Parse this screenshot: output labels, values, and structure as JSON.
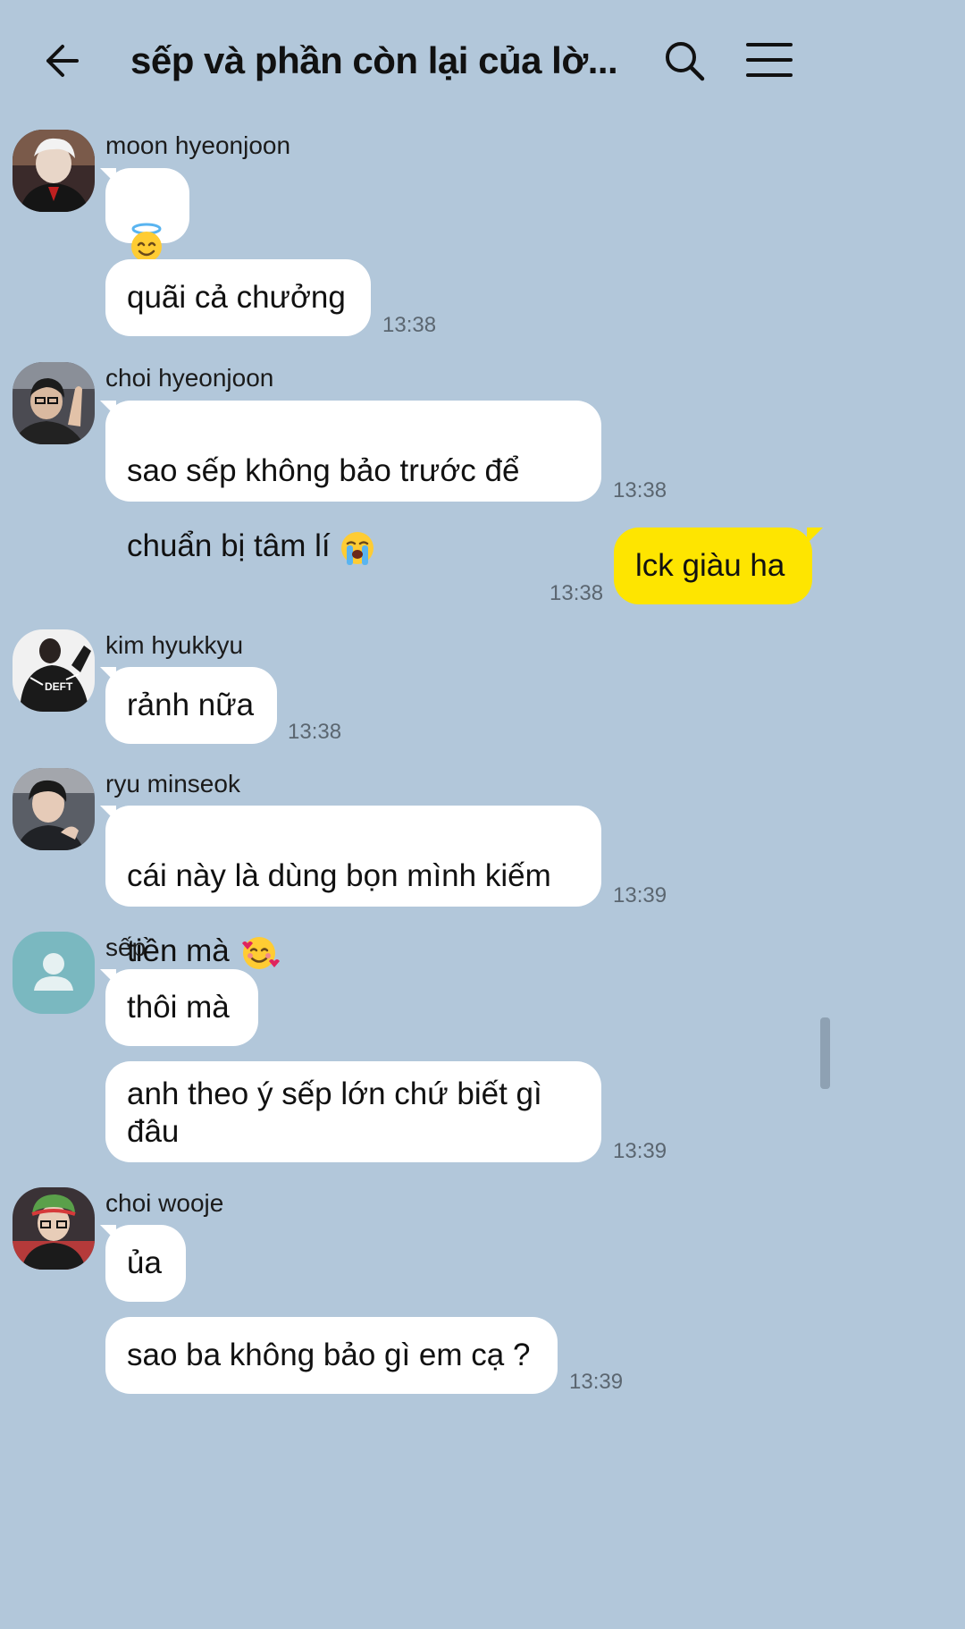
{
  "header": {
    "title": "sếp và phần còn lại của lờ..."
  },
  "messages": [
    {
      "sender": "moon hyeonjoon",
      "emoji": "smiling-face-with-halo",
      "text": "quãi cả chưởng",
      "time": "13:38"
    },
    {
      "sender": "choi hyeonjoon",
      "text_line1": "sao sếp không bảo trước để",
      "text_line2": "chuẩn bị tâm lí",
      "emoji": "loudly-crying-face",
      "time": "13:38"
    },
    {
      "sender": "me",
      "text": "lck giàu ha",
      "time": "13:38"
    },
    {
      "sender": "kim hyukkyu",
      "avatar_text": "DEFT",
      "text": "rảnh nữa",
      "time": "13:38"
    },
    {
      "sender": "ryu minseok",
      "text_line1": "cái này là dùng bọn mình kiếm",
      "text_line2": "tiền mà",
      "emoji": "smiling-face-with-hearts",
      "time": "13:39"
    },
    {
      "sender": "sếp",
      "text1": "thôi mà",
      "text2": "anh theo ý sếp lớn chứ biết gì\nđâu",
      "time": "13:39"
    },
    {
      "sender": "choi wooje",
      "text1": "ủa",
      "text2": "sao ba không bảo gì em cạ ?",
      "time": "13:39"
    }
  ],
  "colors": {
    "background": "#b2c7da",
    "bubble_other": "#ffffff",
    "bubble_mine": "#fee500"
  }
}
